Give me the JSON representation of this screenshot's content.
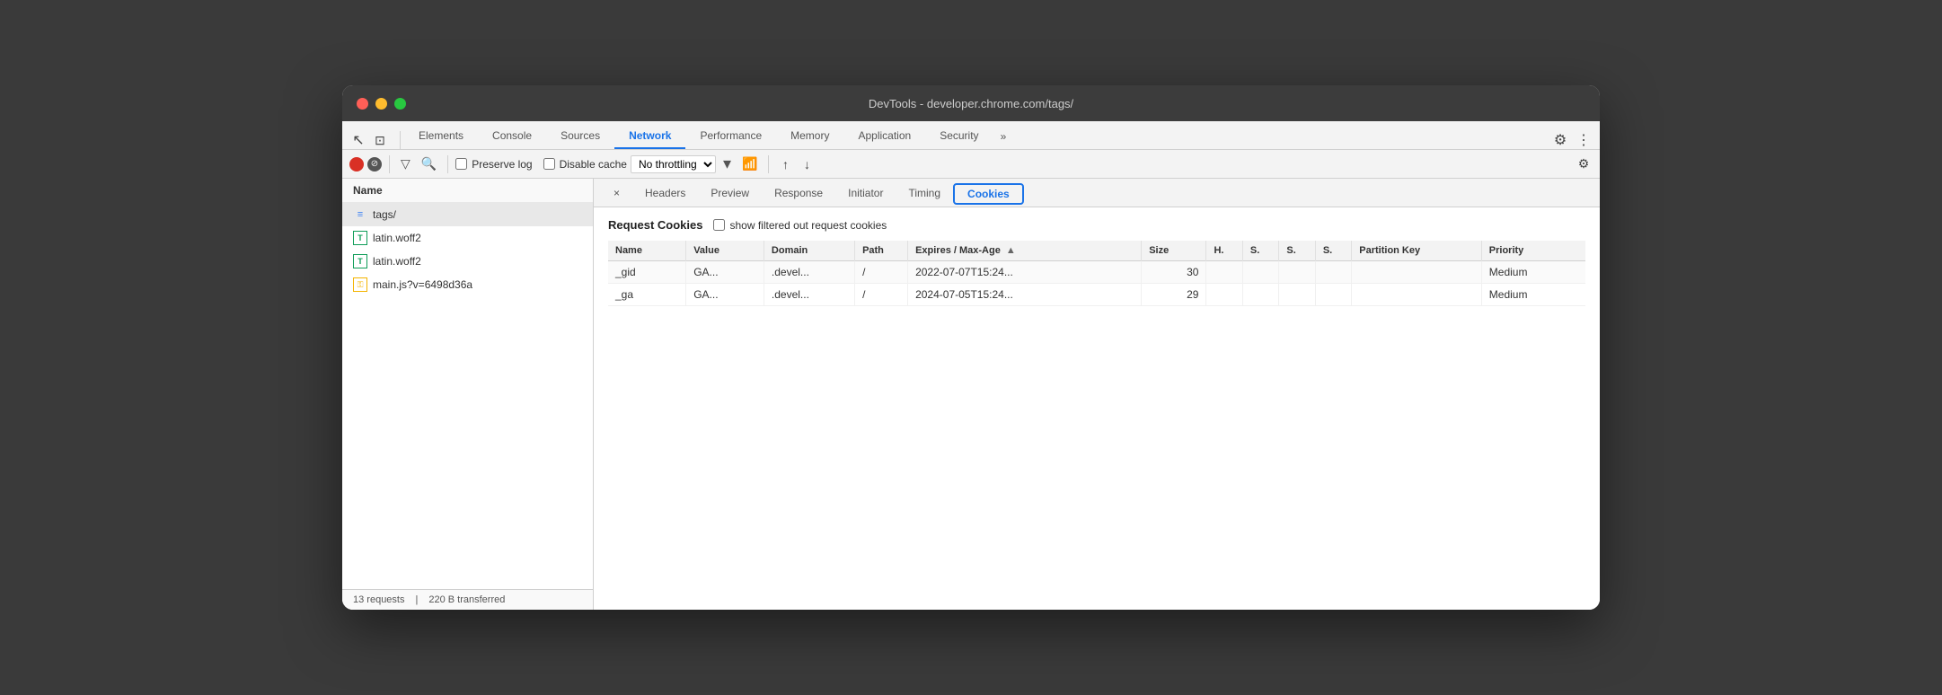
{
  "window": {
    "title": "DevTools - developer.chrome.com/tags/"
  },
  "traffic_lights": {
    "close": "close",
    "minimize": "minimize",
    "maximize": "maximize"
  },
  "tabs": {
    "items": [
      {
        "id": "elements",
        "label": "Elements",
        "active": false
      },
      {
        "id": "console",
        "label": "Console",
        "active": false
      },
      {
        "id": "sources",
        "label": "Sources",
        "active": false
      },
      {
        "id": "network",
        "label": "Network",
        "active": true
      },
      {
        "id": "performance",
        "label": "Performance",
        "active": false
      },
      {
        "id": "memory",
        "label": "Memory",
        "active": false
      },
      {
        "id": "application",
        "label": "Application",
        "active": false
      },
      {
        "id": "security",
        "label": "Security",
        "active": false
      }
    ],
    "more_label": "»",
    "settings_icon": "⚙",
    "dots_icon": "⋮"
  },
  "toolbar2": {
    "preserve_log_label": "Preserve log",
    "disable_cache_label": "Disable cache",
    "throttle_label": "No throttling",
    "upload_icon": "↑",
    "download_icon": "↓",
    "settings_icon": "⚙"
  },
  "left_panel": {
    "header": "Name",
    "files": [
      {
        "id": "tags",
        "icon_type": "html",
        "icon_char": "≡",
        "name": "tags/"
      },
      {
        "id": "latin1",
        "icon_type": "font",
        "icon_char": "T",
        "name": "latin.woff2"
      },
      {
        "id": "latin2",
        "icon_type": "font",
        "icon_char": "T",
        "name": "latin.woff2"
      },
      {
        "id": "mainjs",
        "icon_type": "js",
        "icon_char": "⚿",
        "name": "main.js?v=6498d36a"
      }
    ],
    "footer_requests": "13 requests",
    "footer_transferred": "220 B transferred"
  },
  "sub_tabs": {
    "close_label": "×",
    "items": [
      {
        "id": "headers",
        "label": "Headers",
        "active": false
      },
      {
        "id": "preview",
        "label": "Preview",
        "active": false
      },
      {
        "id": "response",
        "label": "Response",
        "active": false
      },
      {
        "id": "initiator",
        "label": "Initiator",
        "active": false
      },
      {
        "id": "timing",
        "label": "Timing",
        "active": false
      },
      {
        "id": "cookies",
        "label": "Cookies",
        "active": true
      }
    ]
  },
  "cookies_panel": {
    "request_cookies_title": "Request Cookies",
    "show_filtered_label": "show filtered out request cookies",
    "table": {
      "columns": [
        {
          "id": "name",
          "label": "Name"
        },
        {
          "id": "value",
          "label": "Value"
        },
        {
          "id": "domain",
          "label": "Domain"
        },
        {
          "id": "path",
          "label": "Path"
        },
        {
          "id": "expires",
          "label": "Expires / Max-Age",
          "sorted": "asc"
        },
        {
          "id": "size",
          "label": "Size"
        },
        {
          "id": "h",
          "label": "H."
        },
        {
          "id": "s1",
          "label": "S."
        },
        {
          "id": "s2",
          "label": "S."
        },
        {
          "id": "s3",
          "label": "S."
        },
        {
          "id": "partition_key",
          "label": "Partition Key"
        },
        {
          "id": "priority",
          "label": "Priority"
        }
      ],
      "rows": [
        {
          "name": "_gid",
          "value": "GA...",
          "domain": ".devel...",
          "path": "/",
          "expires": "2022-07-07T15:24...",
          "size": "30",
          "h": "",
          "s1": "",
          "s2": "",
          "s3": "",
          "partition_key": "",
          "priority": "Medium"
        },
        {
          "name": "_ga",
          "value": "GA...",
          "domain": ".devel...",
          "path": "/",
          "expires": "2024-07-05T15:24...",
          "size": "29",
          "h": "",
          "s1": "",
          "s2": "",
          "s3": "",
          "partition_key": "",
          "priority": "Medium"
        }
      ]
    }
  }
}
